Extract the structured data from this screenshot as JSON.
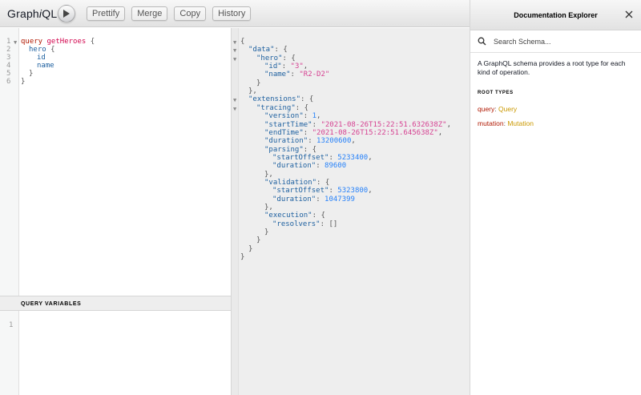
{
  "toolbar": {
    "title_prefix": "Graph",
    "title_suffix": "i",
    "title_end": "QL",
    "buttons": [
      "Prettify",
      "Merge",
      "Copy",
      "History"
    ]
  },
  "query_editor": {
    "line_numbers": [
      "1",
      "2",
      "3",
      "4",
      "5",
      "6"
    ],
    "keyword": "query",
    "operation_name": "getHeroes",
    "open_brace": "{",
    "field_hero": "hero",
    "field_id": "id",
    "field_name": "name",
    "close_brace": "}"
  },
  "query_variables": {
    "header": "QUERY VARIABLES",
    "line_numbers": [
      "1"
    ]
  },
  "result": {
    "lines": [
      {
        "indent": 0,
        "fold": true,
        "parts": [
          [
            "punc",
            "{"
          ]
        ]
      },
      {
        "indent": 1,
        "fold": true,
        "parts": [
          [
            "prop",
            "\"data\""
          ],
          [
            "punc",
            ": {"
          ]
        ]
      },
      {
        "indent": 2,
        "fold": true,
        "parts": [
          [
            "prop",
            "\"hero\""
          ],
          [
            "punc",
            ": {"
          ]
        ]
      },
      {
        "indent": 3,
        "fold": false,
        "parts": [
          [
            "prop",
            "\"id\""
          ],
          [
            "punc",
            ": "
          ],
          [
            "str",
            "\"3\""
          ],
          [
            "punc",
            ","
          ]
        ]
      },
      {
        "indent": 3,
        "fold": false,
        "parts": [
          [
            "prop",
            "\"name\""
          ],
          [
            "punc",
            ": "
          ],
          [
            "str",
            "\"R2-D2\""
          ]
        ]
      },
      {
        "indent": 2,
        "fold": false,
        "parts": [
          [
            "punc",
            "}"
          ]
        ]
      },
      {
        "indent": 1,
        "fold": false,
        "parts": [
          [
            "punc",
            "},"
          ]
        ]
      },
      {
        "indent": 1,
        "fold": true,
        "parts": [
          [
            "prop",
            "\"extensions\""
          ],
          [
            "punc",
            ": {"
          ]
        ]
      },
      {
        "indent": 2,
        "fold": true,
        "parts": [
          [
            "prop",
            "\"tracing\""
          ],
          [
            "punc",
            ": {"
          ]
        ]
      },
      {
        "indent": 3,
        "fold": false,
        "parts": [
          [
            "prop",
            "\"version\""
          ],
          [
            "punc",
            ": "
          ],
          [
            "num",
            "1"
          ],
          [
            "punc",
            ","
          ]
        ]
      },
      {
        "indent": 3,
        "fold": false,
        "parts": [
          [
            "prop",
            "\"startTime\""
          ],
          [
            "punc",
            ": "
          ],
          [
            "str",
            "\"2021-08-26T15:22:51.632638Z\""
          ],
          [
            "punc",
            ","
          ]
        ]
      },
      {
        "indent": 3,
        "fold": false,
        "parts": [
          [
            "prop",
            "\"endTime\""
          ],
          [
            "punc",
            ": "
          ],
          [
            "str",
            "\"2021-08-26T15:22:51.645638Z\""
          ],
          [
            "punc",
            ","
          ]
        ]
      },
      {
        "indent": 3,
        "fold": false,
        "parts": [
          [
            "prop",
            "\"duration\""
          ],
          [
            "punc",
            ": "
          ],
          [
            "num",
            "13200600"
          ],
          [
            "punc",
            ","
          ]
        ]
      },
      {
        "indent": 3,
        "fold": false,
        "parts": [
          [
            "prop",
            "\"parsing\""
          ],
          [
            "punc",
            ": {"
          ]
        ]
      },
      {
        "indent": 4,
        "fold": false,
        "parts": [
          [
            "prop",
            "\"startOffset\""
          ],
          [
            "punc",
            ": "
          ],
          [
            "num",
            "5233400"
          ],
          [
            "punc",
            ","
          ]
        ]
      },
      {
        "indent": 4,
        "fold": false,
        "parts": [
          [
            "prop",
            "\"duration\""
          ],
          [
            "punc",
            ": "
          ],
          [
            "num",
            "89600"
          ]
        ]
      },
      {
        "indent": 3,
        "fold": false,
        "parts": [
          [
            "punc",
            "},"
          ]
        ]
      },
      {
        "indent": 3,
        "fold": false,
        "parts": [
          [
            "prop",
            "\"validation\""
          ],
          [
            "punc",
            ": {"
          ]
        ]
      },
      {
        "indent": 4,
        "fold": false,
        "parts": [
          [
            "prop",
            "\"startOffset\""
          ],
          [
            "punc",
            ": "
          ],
          [
            "num",
            "5323800"
          ],
          [
            "punc",
            ","
          ]
        ]
      },
      {
        "indent": 4,
        "fold": false,
        "parts": [
          [
            "prop",
            "\"duration\""
          ],
          [
            "punc",
            ": "
          ],
          [
            "num",
            "1047399"
          ]
        ]
      },
      {
        "indent": 3,
        "fold": false,
        "parts": [
          [
            "punc",
            "},"
          ]
        ]
      },
      {
        "indent": 3,
        "fold": false,
        "parts": [
          [
            "prop",
            "\"execution\""
          ],
          [
            "punc",
            ": {"
          ]
        ]
      },
      {
        "indent": 4,
        "fold": false,
        "parts": [
          [
            "prop",
            "\"resolvers\""
          ],
          [
            "punc",
            ": "
          ],
          [
            "punc",
            "[]"
          ]
        ]
      },
      {
        "indent": 3,
        "fold": false,
        "parts": [
          [
            "punc",
            "}"
          ]
        ]
      },
      {
        "indent": 2,
        "fold": false,
        "parts": [
          [
            "punc",
            "}"
          ]
        ]
      },
      {
        "indent": 1,
        "fold": false,
        "parts": [
          [
            "punc",
            "}"
          ]
        ]
      },
      {
        "indent": 0,
        "fold": false,
        "parts": [
          [
            "punc",
            "}"
          ]
        ]
      }
    ]
  },
  "docs": {
    "title": "Documentation Explorer",
    "search_placeholder": "Search Schema...",
    "description": "A GraphQL schema provides a root type for each kind of operation.",
    "section_title": "ROOT TYPES",
    "root_types": [
      {
        "field": "query",
        "type": "Query"
      },
      {
        "field": "mutation",
        "type": "Mutation"
      }
    ]
  },
  "colors": {
    "keyword": "#b11a04",
    "def": "#d2054e",
    "property": "#1f61a0",
    "string": "#d64292",
    "number": "#2882f9",
    "type": "#ca9800"
  }
}
